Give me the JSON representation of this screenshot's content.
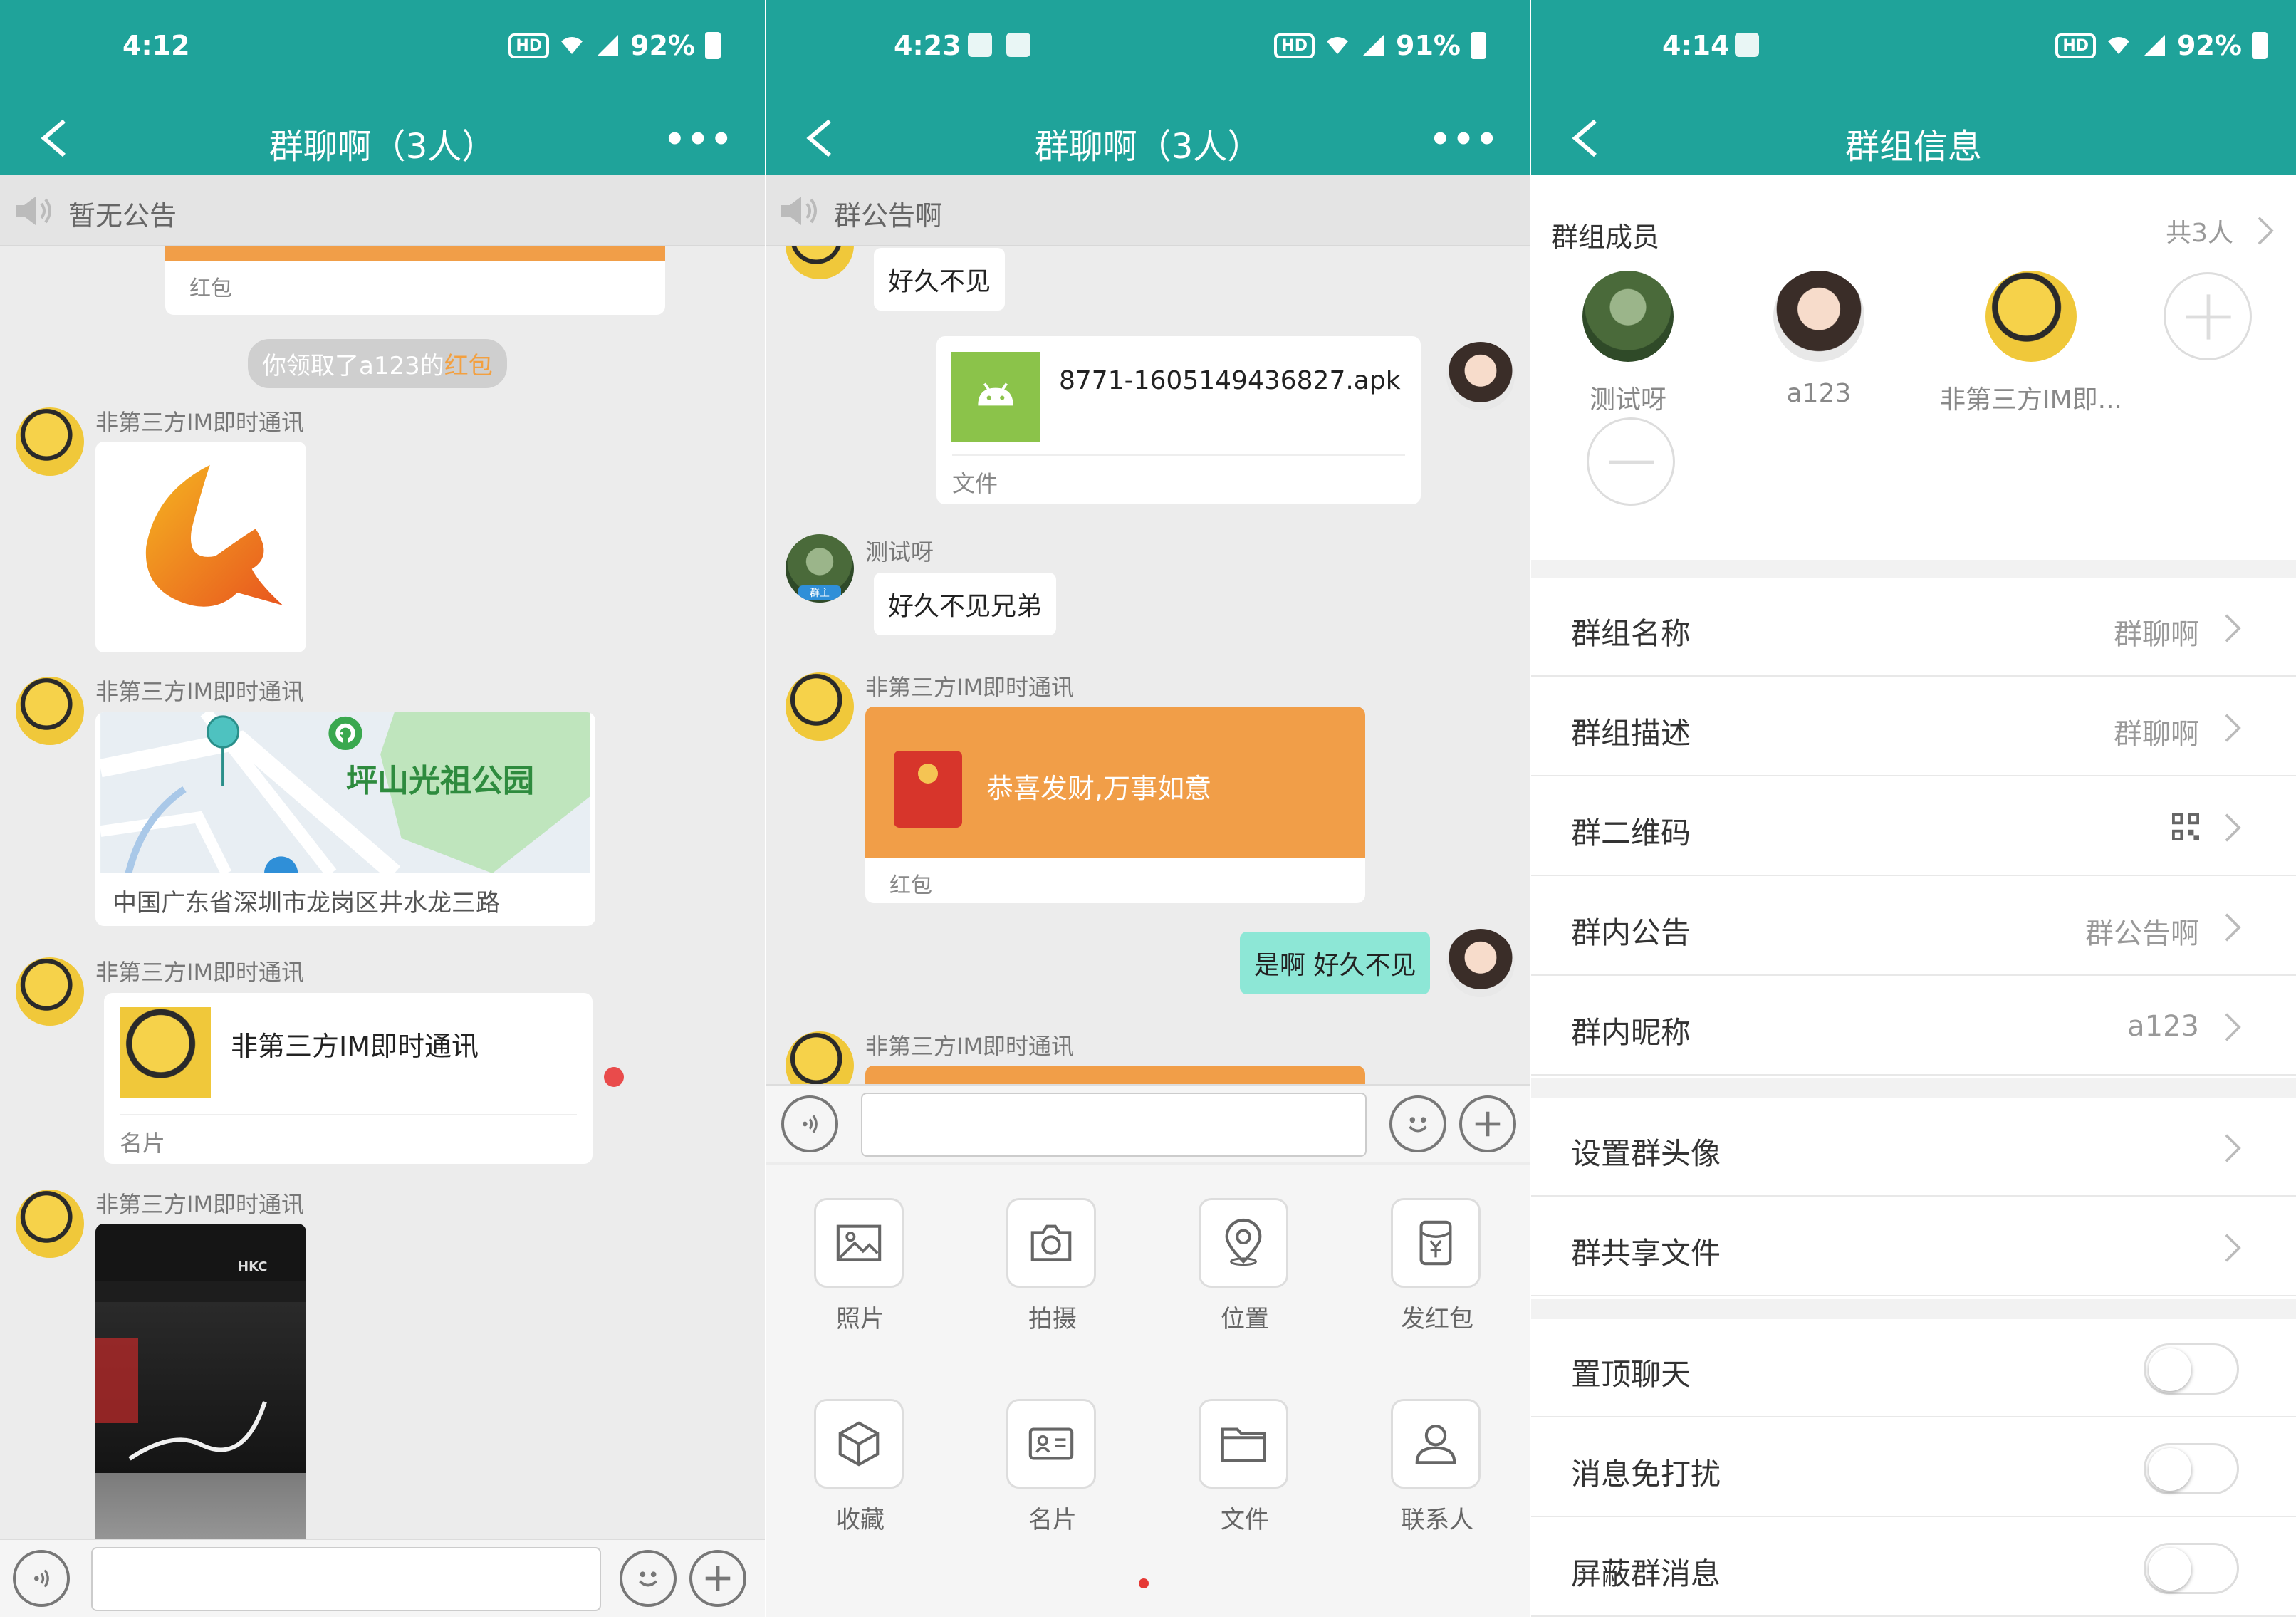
{
  "colors": {
    "accent": "#1fa39a",
    "redpacket": "#f19e48",
    "bubble_self": "#8de7d6"
  },
  "screens": {
    "left": {
      "status": {
        "time": "4:12",
        "battery": "92%",
        "hd": "HD"
      },
      "header": {
        "title": "群聊啊（3人）"
      },
      "notice": "暂无公告",
      "messages": {
        "red_packet_tag": "红包",
        "system_prefix": "你领取了a123的",
        "system_link": "红包",
        "sender_1": "非第三方IM即时通讯",
        "sender_2": "非第三方IM即时通讯",
        "map_place": "坪山光祖公园",
        "map_address": "中国广东省深圳市龙岗区井水龙三路",
        "sender_3": "非第三方IM即时通讯",
        "card_name": "非第三方IM即时通讯",
        "card_tag": "名片",
        "sender_4": "非第三方IM即时通讯",
        "photo_brand": "HKC"
      }
    },
    "middle": {
      "status": {
        "time": "4:23",
        "battery": "91%",
        "hd": "HD"
      },
      "header": {
        "title": "群聊啊（3人）"
      },
      "notice": "群公告啊",
      "messages": {
        "msg_1": "好久不见",
        "file_name": "8771-1605149436827.apk",
        "file_tag": "文件",
        "sender_test": "测试呀",
        "owner_badge": "群主",
        "msg_2": "好久不见兄弟",
        "sender_im": "非第三方IM即时通讯",
        "redpacket_text": "恭喜发财,万事如意",
        "redpacket_tag": "红包",
        "msg_self": "是啊 好久不见",
        "sender_im_2": "非第三方IM即时通讯"
      },
      "tools": [
        {
          "label": "照片",
          "icon": "photo-icon"
        },
        {
          "label": "拍摄",
          "icon": "camera-icon"
        },
        {
          "label": "位置",
          "icon": "location-icon"
        },
        {
          "label": "发红包",
          "icon": "red-packet-icon"
        },
        {
          "label": "收藏",
          "icon": "favorite-icon"
        },
        {
          "label": "名片",
          "icon": "contact-card-icon"
        },
        {
          "label": "文件",
          "icon": "folder-icon"
        },
        {
          "label": "联系人",
          "icon": "contacts-icon"
        }
      ]
    },
    "right": {
      "status": {
        "time": "4:14",
        "battery": "92%",
        "hd": "HD"
      },
      "header": {
        "title": "群组信息"
      },
      "members_title": "群组成员",
      "members_count": "共3人",
      "members": [
        {
          "name": "测试呀"
        },
        {
          "name": "a123"
        },
        {
          "name": "非第三方IM即..."
        }
      ],
      "rows_1": [
        {
          "label": "群组名称",
          "value": "群聊啊"
        },
        {
          "label": "群组描述",
          "value": "群聊啊"
        },
        {
          "label": "群二维码",
          "value": ""
        },
        {
          "label": "群内公告",
          "value": "群公告啊"
        },
        {
          "label": "群内昵称",
          "value": "a123"
        }
      ],
      "rows_2": [
        {
          "label": "设置群头像"
        },
        {
          "label": "群共享文件"
        }
      ],
      "toggles": [
        {
          "label": "置顶聊天",
          "on": false
        },
        {
          "label": "消息免打扰",
          "on": false
        },
        {
          "label": "屏蔽群消息",
          "on": false
        }
      ]
    }
  }
}
